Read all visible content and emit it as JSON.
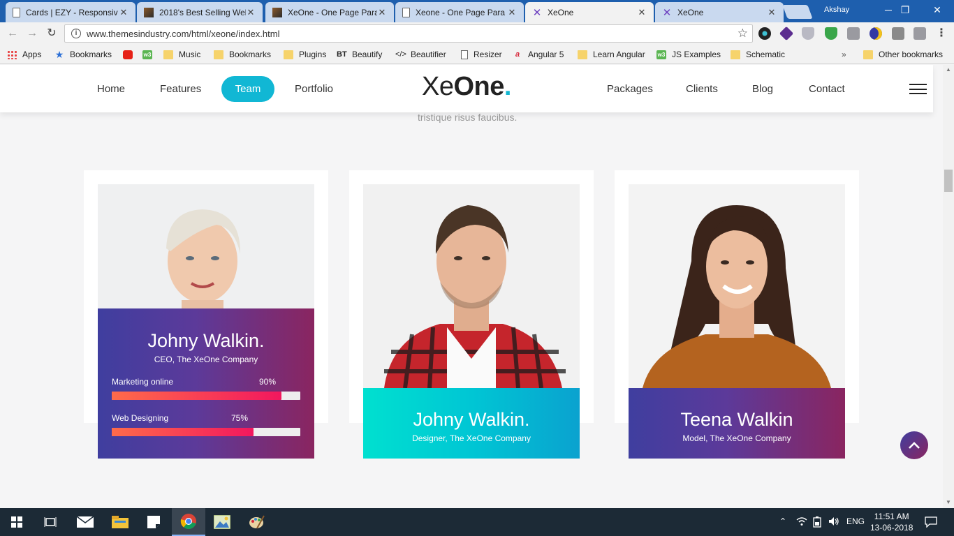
{
  "browser": {
    "tabs": [
      {
        "title": "Cards | EZY - Responsiv",
        "favicon": "doc-icon",
        "active": false
      },
      {
        "title": "2018's Best Selling Web",
        "favicon": "image-icon",
        "active": false
      },
      {
        "title": "XeOne - One Page Para",
        "favicon": "image-icon",
        "active": false
      },
      {
        "title": "Xeone - One Page Para",
        "favicon": "doc-icon",
        "active": false
      },
      {
        "title": "XeOne",
        "favicon": "xeone-icon",
        "active": true
      },
      {
        "title": "XeOne",
        "favicon": "xeone-icon",
        "active": false
      }
    ],
    "profile": "Akshay",
    "url": "www.themesindustry.com/html/xeone/index.html",
    "bookmarks": [
      {
        "label": "Apps",
        "icon": "apps-grid-icon"
      },
      {
        "label": "Bookmarks",
        "icon": "star-icon"
      },
      {
        "label": "",
        "icon": "youtube-icon"
      },
      {
        "label": "",
        "icon": "w3-icon"
      },
      {
        "label": "Music",
        "icon": "folder-icon"
      },
      {
        "label": "Bookmarks",
        "icon": "folder-icon"
      },
      {
        "label": "Plugins",
        "icon": "folder-icon"
      },
      {
        "label": "Beautify",
        "icon": "bt-icon"
      },
      {
        "label": "Beautifier",
        "icon": "code-icon"
      },
      {
        "label": "Resizer",
        "icon": "doc-icon"
      },
      {
        "label": "Angular 5",
        "icon": "angular-icon"
      },
      {
        "label": "Learn Angular",
        "icon": "folder-icon"
      },
      {
        "label": "JS Examples",
        "icon": "w3-icon"
      },
      {
        "label": "Schematic",
        "icon": "folder-icon"
      }
    ],
    "more_bookmarks": "»",
    "other_bookmarks": "Other bookmarks"
  },
  "site": {
    "nav_left": [
      "Home",
      "Features",
      "Team",
      "Portfolio"
    ],
    "nav_right": [
      "Packages",
      "Clients",
      "Blog",
      "Contact"
    ],
    "active_nav": "Team",
    "logo": {
      "part1": "Xe",
      "part2": "One",
      "dot": "."
    },
    "tagline": "tristique risus faucibus.",
    "accent_color": "#11b7d4",
    "team": [
      {
        "name": "Johny Walkin.",
        "role": "CEO, The XeOne Company",
        "skills": [
          {
            "label": "Marketing online",
            "percent_text": "90%",
            "value": 90
          },
          {
            "label": "Web Designing",
            "percent_text": "75%",
            "value": 75
          }
        ]
      },
      {
        "name": "Johny Walkin.",
        "role": "Designer, The XeOne Company"
      },
      {
        "name": "Teena Walkin",
        "role": "Model, The XeOne Company"
      }
    ]
  },
  "taskbar": {
    "lang": "ENG",
    "time": "11:51 AM",
    "date": "13-06-2018"
  }
}
